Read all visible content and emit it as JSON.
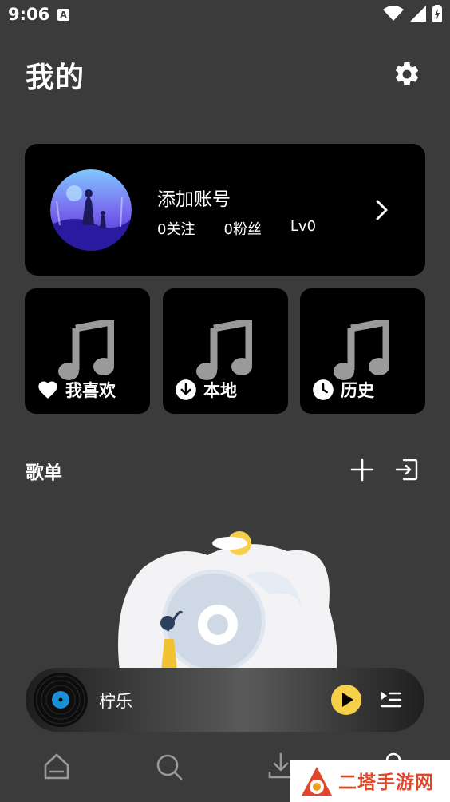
{
  "status_bar": {
    "time": "9:06",
    "notification_badge": "A"
  },
  "header": {
    "title": "我的"
  },
  "account": {
    "name": "添加账号",
    "following": "0关注",
    "followers": "0粉丝",
    "level": "Lv0"
  },
  "tiles": [
    {
      "label": "我喜欢",
      "icon": "heart-icon"
    },
    {
      "label": "本地",
      "icon": "download-icon"
    },
    {
      "label": "历史",
      "icon": "clock-icon"
    }
  ],
  "playlists": {
    "title": "歌单"
  },
  "player": {
    "title": "柠乐",
    "accent": "#f6d04a"
  },
  "nav": [
    "home-icon",
    "search-icon",
    "download-icon",
    "profile-icon"
  ],
  "watermark": {
    "text": "二塔手游网"
  }
}
